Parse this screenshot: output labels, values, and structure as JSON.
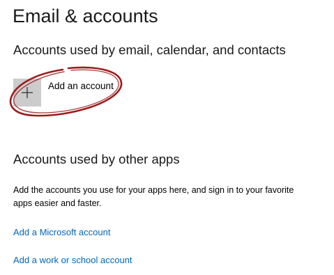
{
  "page": {
    "title": "Email & accounts"
  },
  "email_section": {
    "heading": "Accounts used by email, calendar, and contacts",
    "add_account": {
      "icon": "plus-icon",
      "label": "Add an account"
    },
    "annotation_color": "#9b1c1c"
  },
  "other_apps_section": {
    "heading": "Accounts used by other apps",
    "description": "Add the accounts you use for your apps here, and sign in to your favorite apps easier and faster.",
    "links": [
      {
        "label": "Add a Microsoft account"
      },
      {
        "label": "Add a work or school account"
      }
    ]
  },
  "colors": {
    "link": "#0067b8",
    "tile": "#cccccc"
  }
}
